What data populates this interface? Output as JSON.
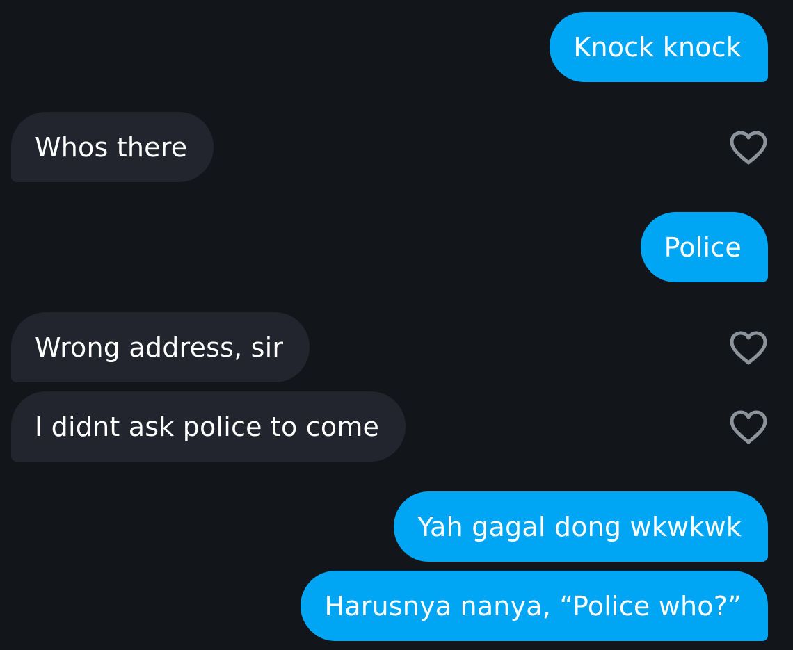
{
  "conversation": {
    "messages": [
      {
        "text": "Knock knock",
        "direction": "sent"
      },
      {
        "text": "Whos there",
        "direction": "received",
        "liked": false
      },
      {
        "text": "Police",
        "direction": "sent"
      },
      {
        "text": "Wrong address, sir",
        "direction": "received",
        "liked": false
      },
      {
        "text": "I didnt ask police to come",
        "direction": "received",
        "liked": false
      },
      {
        "text": "Yah gagal dong wkwkwk",
        "direction": "sent"
      },
      {
        "text": "Harusnya nanya, “Police who?”",
        "direction": "sent"
      }
    ]
  },
  "icons": {
    "like": "heart-outline-icon"
  },
  "colors": {
    "background": "#121519",
    "sent_bubble": "#00a5f4",
    "received_bubble": "#22252e",
    "heart_outline": "#8e939b",
    "text": "#ffffff"
  }
}
